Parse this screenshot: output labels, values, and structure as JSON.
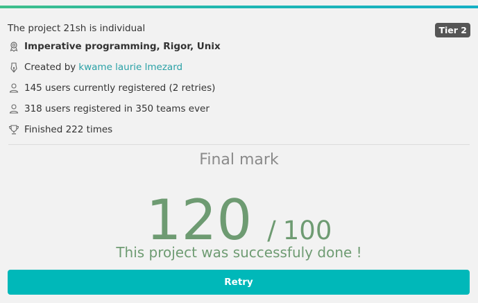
{
  "project": {
    "title": "The project 21sh is individual",
    "tier": "Tier 2",
    "skills": "Imperative programming, Rigor, Unix",
    "created_by_label": "Created by",
    "creators": "kwame laurie lmezard",
    "current_registrations": "145 users currently registered (2 retries)",
    "total_registrations": "318 users registered in 350 teams ever",
    "finished": "Finished 222 times"
  },
  "mark": {
    "title": "Final mark",
    "value": "120",
    "separator": "/",
    "max": "100",
    "message": "This project was successfuly done !"
  },
  "actions": {
    "retry_label": "Retry"
  },
  "colors": {
    "accent": "#00b8b9",
    "success": "#6e9b72",
    "link": "#2aa1a6",
    "badge": "#565656"
  },
  "icons": [
    "skills-icon",
    "creator-pen-icon",
    "user-icon",
    "users-icon",
    "trophy-icon"
  ]
}
